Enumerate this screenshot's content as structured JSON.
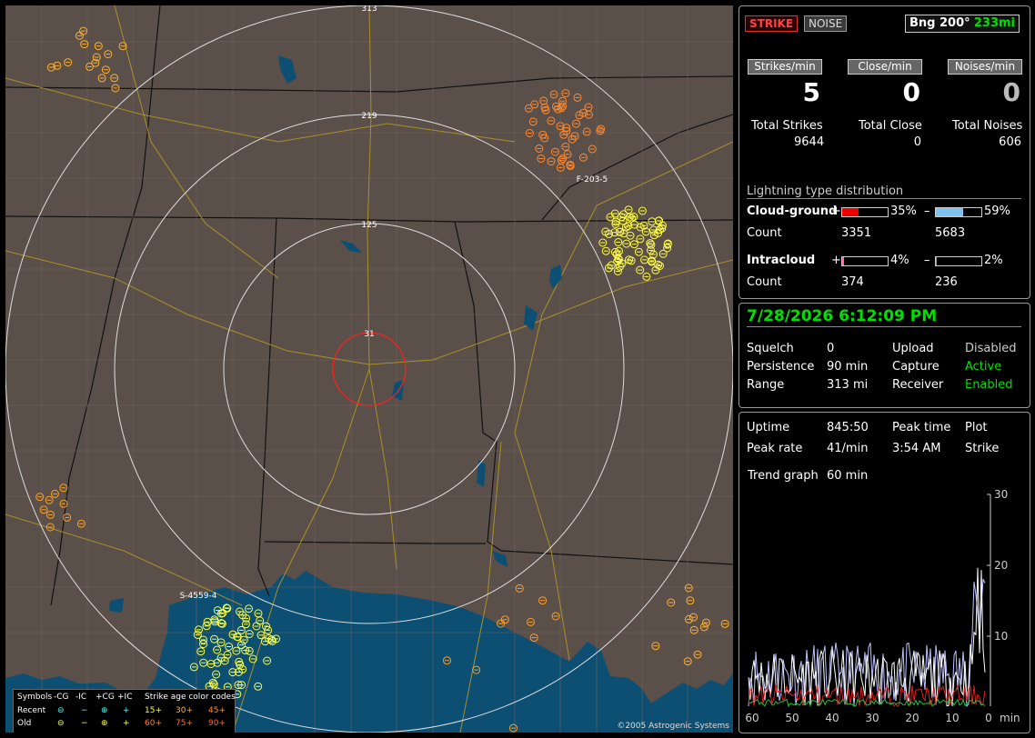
{
  "map": {
    "range_labels": [
      "31",
      "125",
      "219",
      "313"
    ],
    "storm_labels": [
      "F-203-5",
      "S-4559-4"
    ],
    "legend": {
      "symbols_label": "Symbols",
      "cols": [
        "-CG",
        "-IC",
        "+CG",
        "+IC"
      ],
      "age_label": "Strike age color codes",
      "recent_label": "Recent",
      "old_label": "Old",
      "recent_ages": [
        "15+",
        "30+",
        "45+"
      ],
      "old_ages": [
        "60+",
        "75+",
        "90+"
      ]
    },
    "copyright": "©2005 Astrogenic Systems",
    "colors": {
      "land": "#5b4f4a",
      "water": "#0c4f72",
      "range_ring": "#dddddd",
      "close_ring": "#ff2020",
      "recent": "#ffff40",
      "mid": "#ffb030",
      "old": "#ff7a20"
    }
  },
  "status": {
    "strike_label": "STRIKE",
    "noise_label": "NOISE",
    "bearing": "Bng 200°",
    "distance": "233mi",
    "rates": [
      {
        "label": "Strikes/min",
        "value": "5",
        "total_label": "Total Strikes",
        "total": "9644"
      },
      {
        "label": "Close/min",
        "value": "0",
        "total_label": "Total Close",
        "total": "0"
      },
      {
        "label": "Noises/min",
        "value": "0",
        "total_label": "Total Noises",
        "total": "606"
      }
    ],
    "dist_title": "Lightning type distribution",
    "cg_label": "Cloud-ground",
    "ic_label": "Intracloud",
    "count_label": "Count",
    "cg_pos_pct": "35%",
    "cg_neg_pct": "59%",
    "cg_pos_count": "3351",
    "cg_neg_count": "5683",
    "ic_pos_pct": "4%",
    "ic_neg_pct": "2%",
    "ic_pos_count": "374",
    "ic_neg_count": "236",
    "cg_pos_frac": 0.35,
    "cg_neg_frac": 0.59,
    "ic_pos_frac": 0.04,
    "ic_neg_frac": 0.02,
    "plus": "+",
    "minus": "–"
  },
  "info": {
    "datetime": "7/28/2026 6:12:09 PM",
    "squelch_label": "Squelch",
    "squelch": "0",
    "persistence_label": "Persistence",
    "persistence": "90 min",
    "range_label": "Range",
    "range": "313 mi",
    "upload_label": "Upload",
    "upload": "Disabled",
    "capture_label": "Capture",
    "capture": "Active",
    "receiver_label": "Receiver",
    "receiver": "Enabled"
  },
  "trend": {
    "uptime_label": "Uptime",
    "uptime": "845:50",
    "peak_time_label": "Peak time",
    "peak_time": "3:54 AM",
    "plot_label": "Plot",
    "plot": "Strike",
    "peak_rate_label": "Peak rate",
    "peak_rate": "41/min",
    "trend_label": "Trend graph",
    "trend_span": "60 min",
    "y_ticks": [
      "30",
      "20",
      "10"
    ],
    "x_ticks": [
      "60",
      "50",
      "40",
      "30",
      "20",
      "10",
      "0"
    ],
    "x_unit": "min"
  }
}
